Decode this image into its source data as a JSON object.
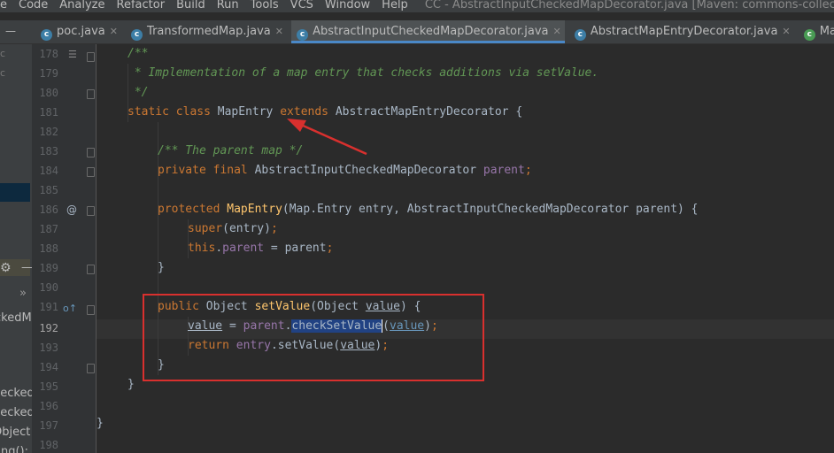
{
  "menu": {
    "items": [
      "e",
      "Code",
      "Analyze",
      "Refactor",
      "Build",
      "Run",
      "Tools",
      "VCS",
      "Window",
      "Help"
    ],
    "window_title": "CC - AbstractInputCheckedMapDecorator.java [Maven: commons-collectio"
  },
  "tabs": [
    {
      "label": "poc.java",
      "icon": "c",
      "active": false
    },
    {
      "label": "TransformedMap.java",
      "icon": "c",
      "active": false
    },
    {
      "label": "AbstractInputCheckedMapDecorator.java",
      "icon": "c",
      "active": true
    },
    {
      "label": "AbstractMapEntryDecorator.java",
      "icon": "c",
      "active": false
    },
    {
      "label": "Ma",
      "icon": "c",
      "active": false
    }
  ],
  "sidebar": {
    "fragments": [
      "ckedMa",
      "»",
      "hecked",
      "necked",
      "Object",
      "ring():"
    ]
  },
  "gutter": {
    "line_numbers": [
      "178",
      "179",
      "180",
      "181",
      "182",
      "183",
      "184",
      "185",
      "186",
      "187",
      "188",
      "189",
      "190",
      "191",
      "192",
      "193",
      "194",
      "195",
      "196",
      "197",
      "198"
    ],
    "current_line": "192",
    "annotation_marker": "@",
    "override_marker": "o↑"
  },
  "code": {
    "l178": "/**",
    "l179": " * Implementation of a map entry that checks additions via setValue.",
    "l180": " */",
    "l181": {
      "static": "static",
      "class": "class",
      "name": "MapEntry",
      "extends": "extends",
      "parent": "AbstractMapEntryDecorator {"
    },
    "l183": "/** The parent map */",
    "l184": {
      "private": "private",
      "final": "final",
      "type": "AbstractInputCheckedMapDecorator",
      "field": "parent",
      "semi": ";"
    },
    "l186": {
      "protected": "protected",
      "name": "MapEntry",
      "params": "(Map.Entry entry, AbstractInputCheckedMapDecorator parent) {"
    },
    "l187": {
      "super": "super",
      "rest": "(entry)",
      "semi": ";"
    },
    "l188": {
      "this": "this",
      "dot": ".",
      "field": "parent",
      "rest": " = parent",
      "semi": ";"
    },
    "l189": "}",
    "l191": {
      "public": "public",
      "type": " Object ",
      "name": "setValue",
      "p1": "(Object ",
      "param": "value",
      "p2": ") {"
    },
    "l192": {
      "var": "value",
      "eq": " = ",
      "field": "parent",
      "dot": ".",
      "call": "checkSetValue",
      "open": "(",
      "arg": "value",
      "close": ")",
      "semi": ";"
    },
    "l193": {
      "ret": "return",
      "sp": " ",
      "field": "entry",
      "call": ".setValue(",
      "arg": "value",
      "close": ")",
      "semi": ";"
    },
    "l194": "}",
    "l195": "}",
    "l197": "}"
  },
  "colors": {
    "annotation_box": "#d9302e",
    "arrow": "#d9302e",
    "keyword": "#cc7832",
    "comment": "#629755",
    "method": "#ffc66d",
    "field": "#9876aa",
    "selection": "#214283"
  }
}
